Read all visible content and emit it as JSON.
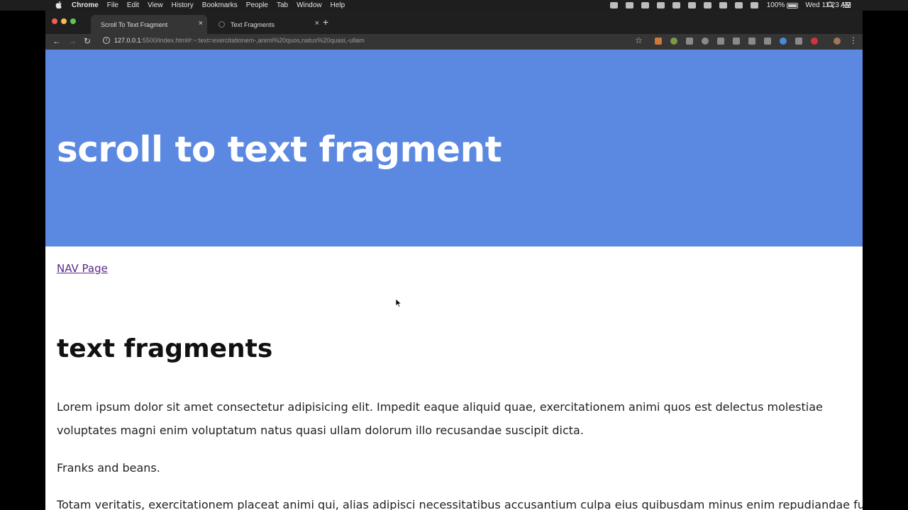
{
  "menubar": {
    "app_name": "Chrome",
    "menus": [
      "File",
      "Edit",
      "View",
      "History",
      "Bookmarks",
      "People",
      "Tab",
      "Window",
      "Help"
    ],
    "battery": "100%",
    "clock": "Wed 11:23 AM"
  },
  "tabs": [
    {
      "title": "Scroll To Text Fragment",
      "active": true
    },
    {
      "title": "Text Fragments",
      "active": false
    }
  ],
  "toolbar": {
    "url_host": "127.0.0.1",
    "url_rest": ":5500/index.html#:~:text=exercitationem-,animi%20quos,natus%20quasi,-ullam"
  },
  "page": {
    "hero_title": "scroll to text fragment",
    "nav_link": "NAV Page",
    "heading": "text fragments",
    "paragraph1": "Lorem ipsum dolor sit amet consectetur adipisicing elit. Impedit eaque aliquid quae, exercitationem animi quos est delectus molestiae voluptates magni enim voluptatum natus quasi ullam dolorum illo recusandae suscipit dicta.",
    "paragraph2": "Franks and beans.",
    "paragraph3": "Totam veritatis, exercitationem placeat animi qui, alias adipisci necessitatibus accusantium culpa eius quibusdam minus enim repudiandae fuga"
  },
  "colors": {
    "hero_bg": "#5b88e1",
    "link": "#5a2a8a"
  }
}
